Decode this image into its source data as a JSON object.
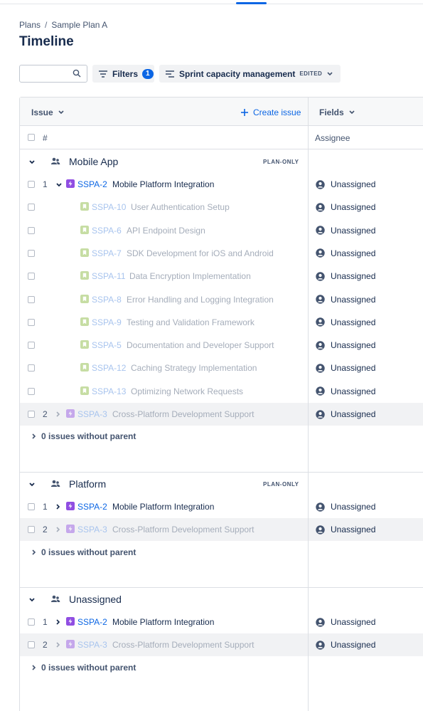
{
  "breadcrumb": {
    "plans": "Plans",
    "separator": "/",
    "plan": "Sample Plan A"
  },
  "page_title": "Timeline",
  "toolbar": {
    "search": {
      "value": "",
      "placeholder": ""
    },
    "filters_label": "Filters",
    "filters_count": "1",
    "sprint_label": "Sprint capacity management",
    "sprint_badge": "EDITED"
  },
  "grid": {
    "issue_header": "Issue",
    "create_issue": "Create issue",
    "fields_header": "Fields",
    "hash_header": "#",
    "assignee_header": "Assignee"
  },
  "colors": {
    "accent": "#0c66e4",
    "epic": "#904ee2",
    "story": "#82b536"
  },
  "groups": [
    {
      "title": "Mobile App",
      "badge": "PLAN-ONLY",
      "no_parent": "0 issues without parent",
      "rows": [
        {
          "num": "1",
          "key": "SSPA-2",
          "title": "Mobile Platform Integration",
          "assignee": "Unassigned",
          "type": "epic",
          "expanded": "true"
        },
        {
          "num": "",
          "key": "SSPA-10",
          "title": "User Authentication Setup",
          "assignee": "Unassigned",
          "type": "story"
        },
        {
          "num": "",
          "key": "SSPA-6",
          "title": "API Endpoint Design",
          "assignee": "Unassigned",
          "type": "story"
        },
        {
          "num": "",
          "key": "SSPA-7",
          "title": "SDK Development for iOS and Android",
          "assignee": "Unassigned",
          "type": "story"
        },
        {
          "num": "",
          "key": "SSPA-11",
          "title": "Data Encryption Implementation",
          "assignee": "Unassigned",
          "type": "story"
        },
        {
          "num": "",
          "key": "SSPA-8",
          "title": "Error Handling and Logging Integration",
          "assignee": "Unassigned",
          "type": "story"
        },
        {
          "num": "",
          "key": "SSPA-9",
          "title": "Testing and Validation Framework",
          "assignee": "Unassigned",
          "type": "story"
        },
        {
          "num": "",
          "key": "SSPA-5",
          "title": "Documentation and Developer Support",
          "assignee": "Unassigned",
          "type": "story"
        },
        {
          "num": "",
          "key": "SSPA-12",
          "title": "Caching Strategy Implementation",
          "assignee": "Unassigned",
          "type": "story"
        },
        {
          "num": "",
          "key": "SSPA-13",
          "title": "Optimizing Network Requests",
          "assignee": "Unassigned",
          "type": "story"
        },
        {
          "num": "2",
          "key": "SSPA-3",
          "title": "Cross-Platform Development Support",
          "assignee": "Unassigned",
          "type": "epic"
        }
      ]
    },
    {
      "title": "Platform",
      "badge": "PLAN-ONLY",
      "no_parent": "0 issues without parent",
      "rows": [
        {
          "num": "1",
          "key": "SSPA-2",
          "title": "Mobile Platform Integration",
          "assignee": "Unassigned",
          "type": "epic"
        },
        {
          "num": "2",
          "key": "SSPA-3",
          "title": "Cross-Platform Development Support",
          "assignee": "Unassigned",
          "type": "epic"
        }
      ]
    },
    {
      "title": "Unassigned",
      "badge": "",
      "no_parent": "0 issues without parent",
      "rows": [
        {
          "num": "1",
          "key": "SSPA-2",
          "title": "Mobile Platform Integration",
          "assignee": "Unassigned",
          "type": "epic"
        },
        {
          "num": "2",
          "key": "SSPA-3",
          "title": "Cross-Platform Development Support",
          "assignee": "Unassigned",
          "type": "epic"
        }
      ]
    }
  ]
}
